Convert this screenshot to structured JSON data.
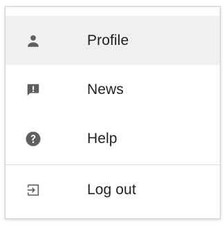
{
  "menu": {
    "items": [
      {
        "label": "Profile",
        "icon": "person-icon",
        "highlighted": true
      },
      {
        "label": "News",
        "icon": "feedback-icon"
      },
      {
        "label": "Help",
        "icon": "help-icon"
      }
    ],
    "logout": {
      "label": "Log out",
      "icon": "logout-icon"
    }
  },
  "colors": {
    "icon": "#5f5f5f",
    "text": "#212121",
    "highlight": "#f0f0f0",
    "divider": "#dcdcdc"
  }
}
